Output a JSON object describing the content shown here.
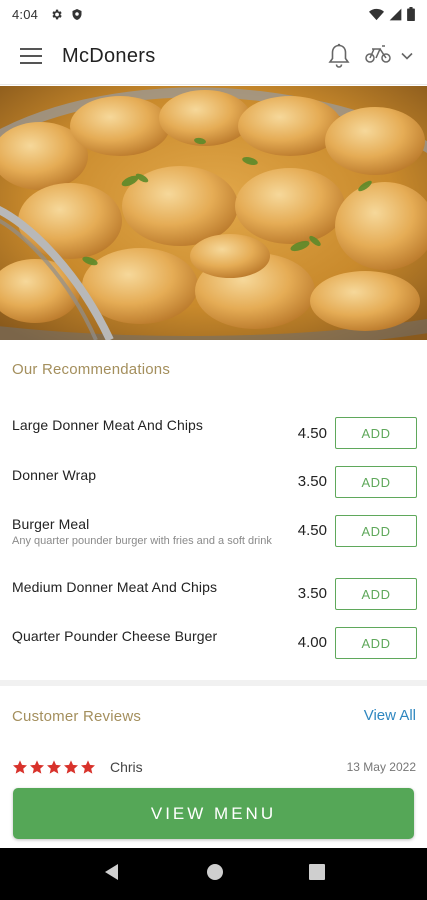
{
  "status_bar": {
    "time": "4:04",
    "left_icons": [
      "gear-icon",
      "shield-icon"
    ],
    "right_icons": [
      "wifi-icon",
      "signal-icon",
      "battery-icon"
    ]
  },
  "app_bar": {
    "title": "McDoners",
    "icons": [
      "hamburger-menu-icon",
      "bell-icon",
      "bikes-icon",
      "chevron-down-icon"
    ]
  },
  "hero": {
    "description_icon": "food-photo"
  },
  "recommendations": {
    "title": "Our Recommendations",
    "items": [
      {
        "name": "Large Donner Meat And Chips",
        "description": "",
        "price": "4.50",
        "button": "ADD"
      },
      {
        "name": "Donner Wrap",
        "description": "",
        "price": "3.50",
        "button": "ADD"
      },
      {
        "name": "Burger Meal",
        "description": "Any quarter pounder burger with fries and a soft drink",
        "price": "4.50",
        "button": "ADD"
      },
      {
        "name": "Medium Donner Meat And Chips",
        "description": "",
        "price": "3.50",
        "button": "ADD"
      },
      {
        "name": "Quarter Pounder Cheese Burger",
        "description": "",
        "price": "4.00",
        "button": "ADD"
      }
    ]
  },
  "reviews": {
    "title": "Customer Reviews",
    "view_all": "View All",
    "items": [
      {
        "reviewer": "Chris",
        "rating": 5,
        "date": "13 May 2022"
      }
    ]
  },
  "view_menu_button": "VIEW MENU",
  "colors": {
    "accent_green": "#55a757",
    "section_title": "#a48f5d",
    "link_blue": "#2f87c0",
    "star_red": "#d8322b"
  }
}
